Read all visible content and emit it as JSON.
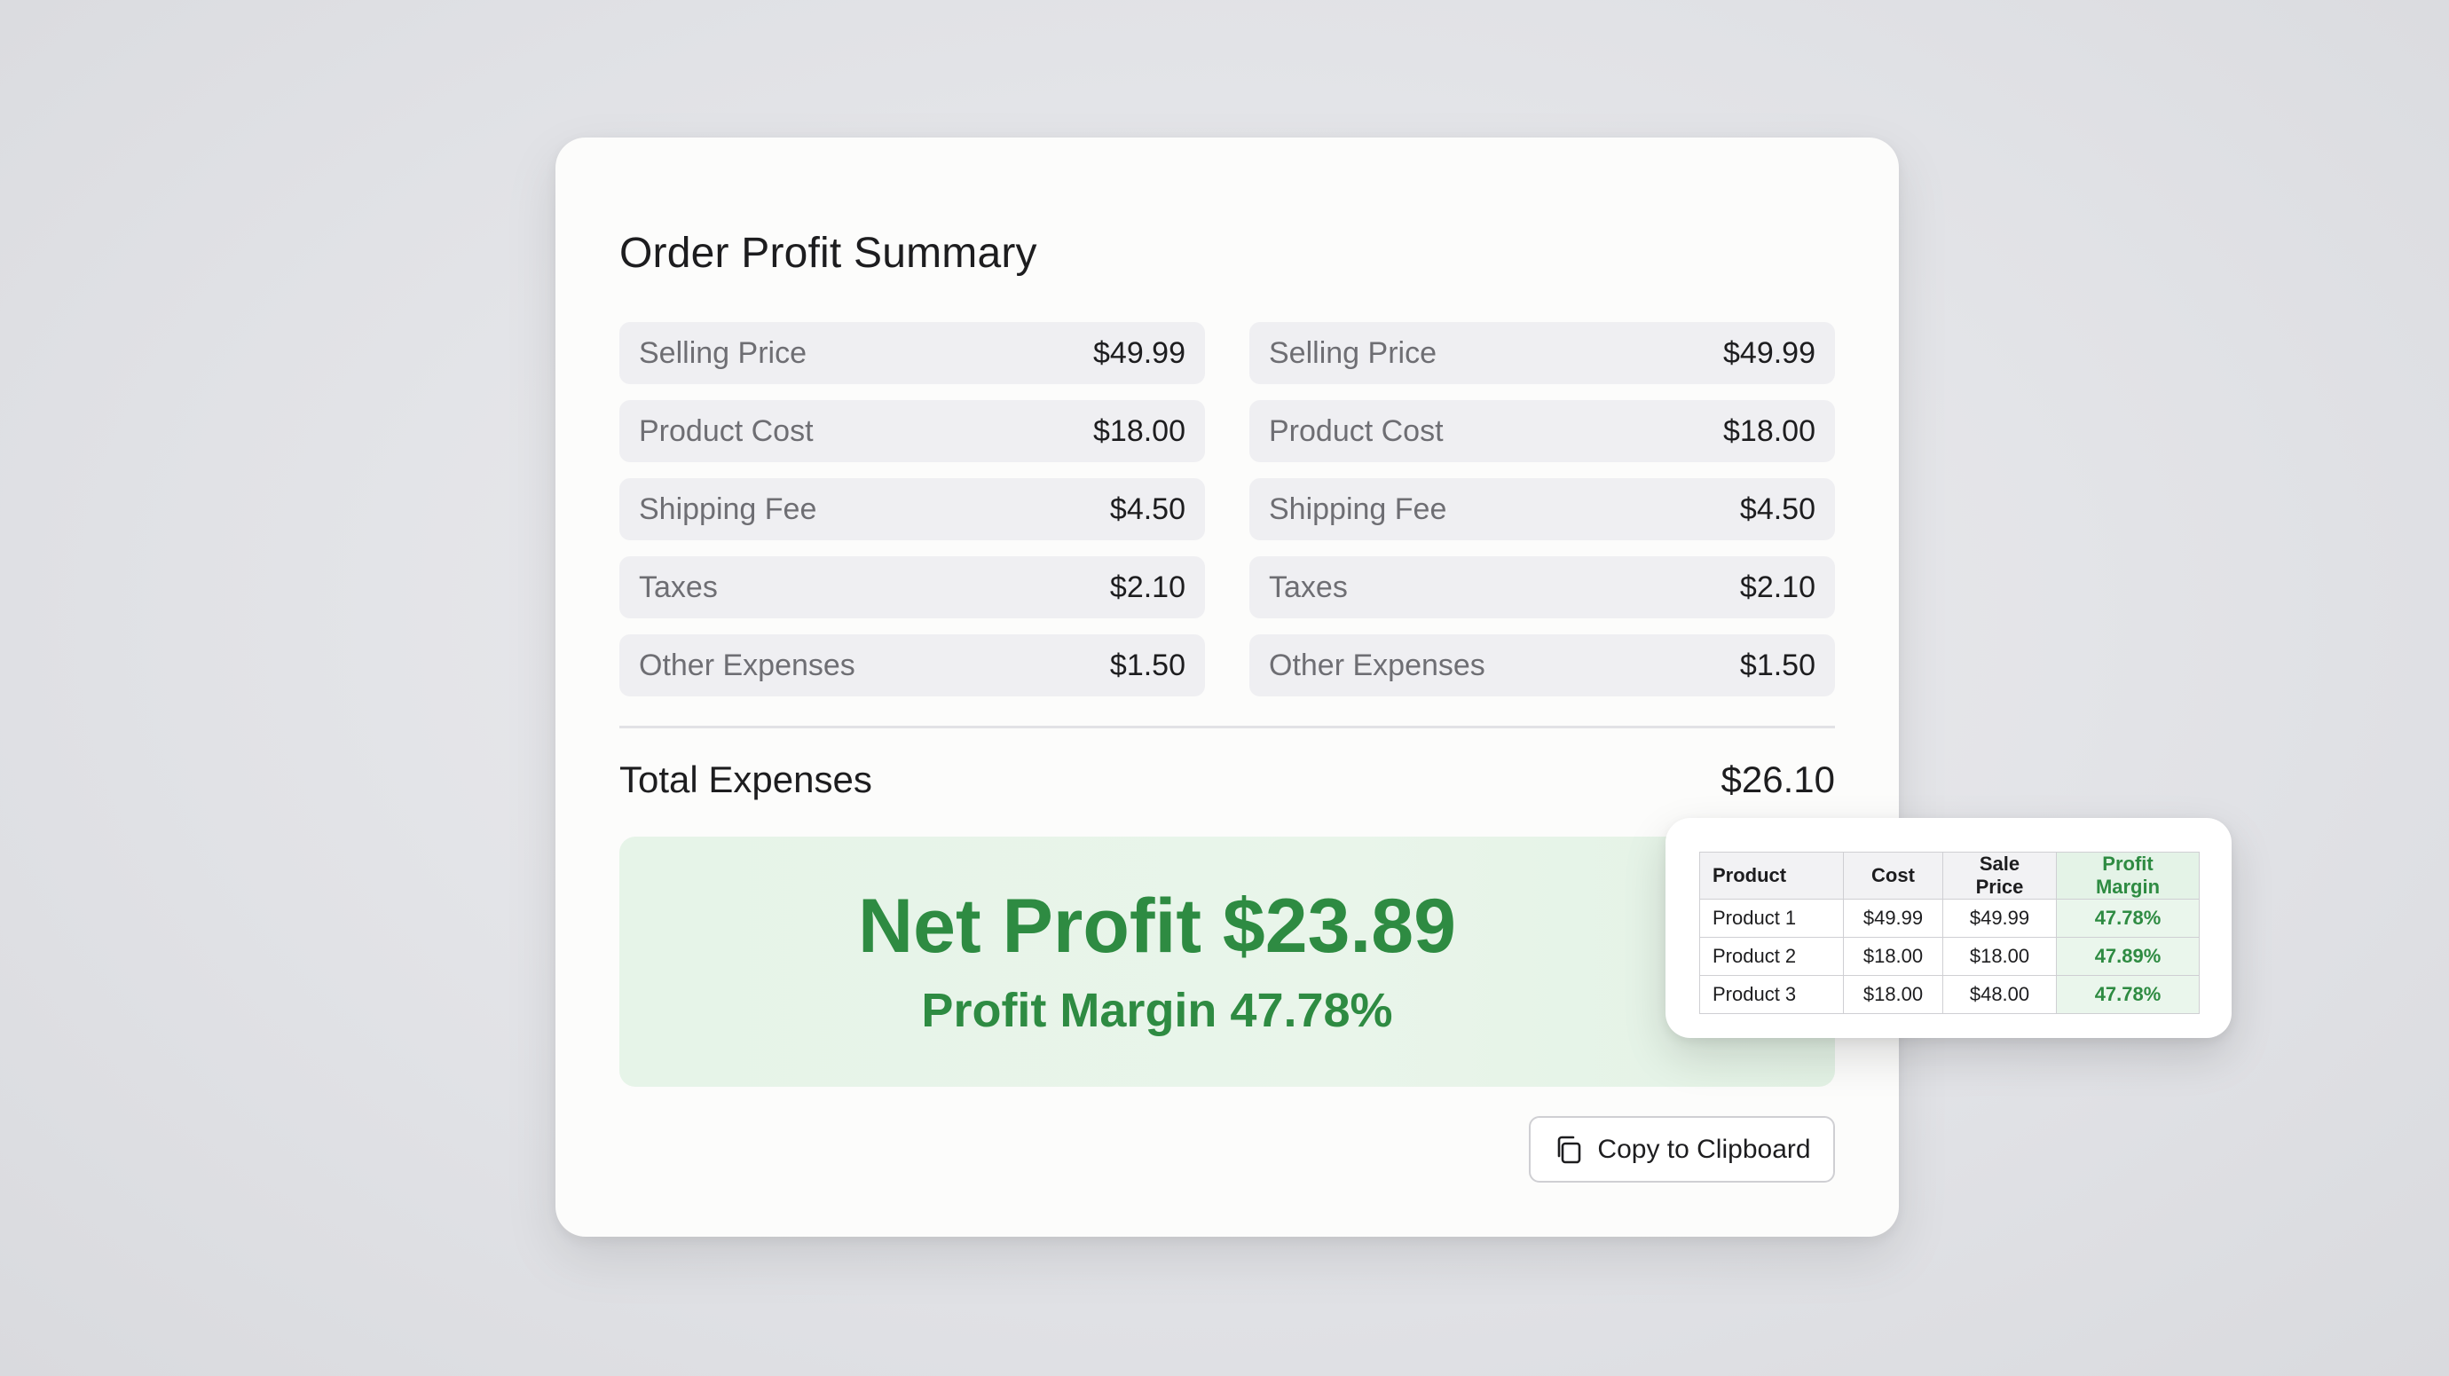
{
  "summary": {
    "title": "Order Profit Summary",
    "left_items": [
      {
        "label": "Selling Price",
        "value": "$49.99"
      },
      {
        "label": "Product Cost",
        "value": "$18.00"
      },
      {
        "label": "Shipping Fee",
        "value": "$4.50"
      },
      {
        "label": "Taxes",
        "value": "$2.10"
      },
      {
        "label": "Other Expenses",
        "value": "$1.50"
      }
    ],
    "right_items": [
      {
        "label": "Selling Price",
        "value": "$49.99"
      },
      {
        "label": "Product Cost",
        "value": "$18.00"
      },
      {
        "label": "Shipping Fee",
        "value": "$4.50"
      },
      {
        "label": "Taxes",
        "value": "$2.10"
      },
      {
        "label": "Other Expenses",
        "value": "$1.50"
      }
    ],
    "total_label": "Total Expenses",
    "total_value": "$26.10",
    "net_profit": "Net Profit $23.89",
    "profit_margin": "Profit Margin 47.78%",
    "copy_button_label": "Copy to Clipboard",
    "copy_icon": "copy-icon"
  },
  "product_table": {
    "headers": [
      "Product",
      "Cost",
      "Sale Price",
      "Profit Margin"
    ],
    "rows": [
      [
        "Product 1",
        "$49.99",
        "$49.99",
        "47.78%"
      ],
      [
        "Product 2",
        "$18.00",
        "$18.00",
        "47.89%"
      ],
      [
        "Product 3",
        "$18.00",
        "$48.00",
        "47.78%"
      ]
    ]
  },
  "colors": {
    "accent_green": "#2e8b42",
    "profit_background": "#e7f5e9",
    "row_background": "#efeff2"
  }
}
